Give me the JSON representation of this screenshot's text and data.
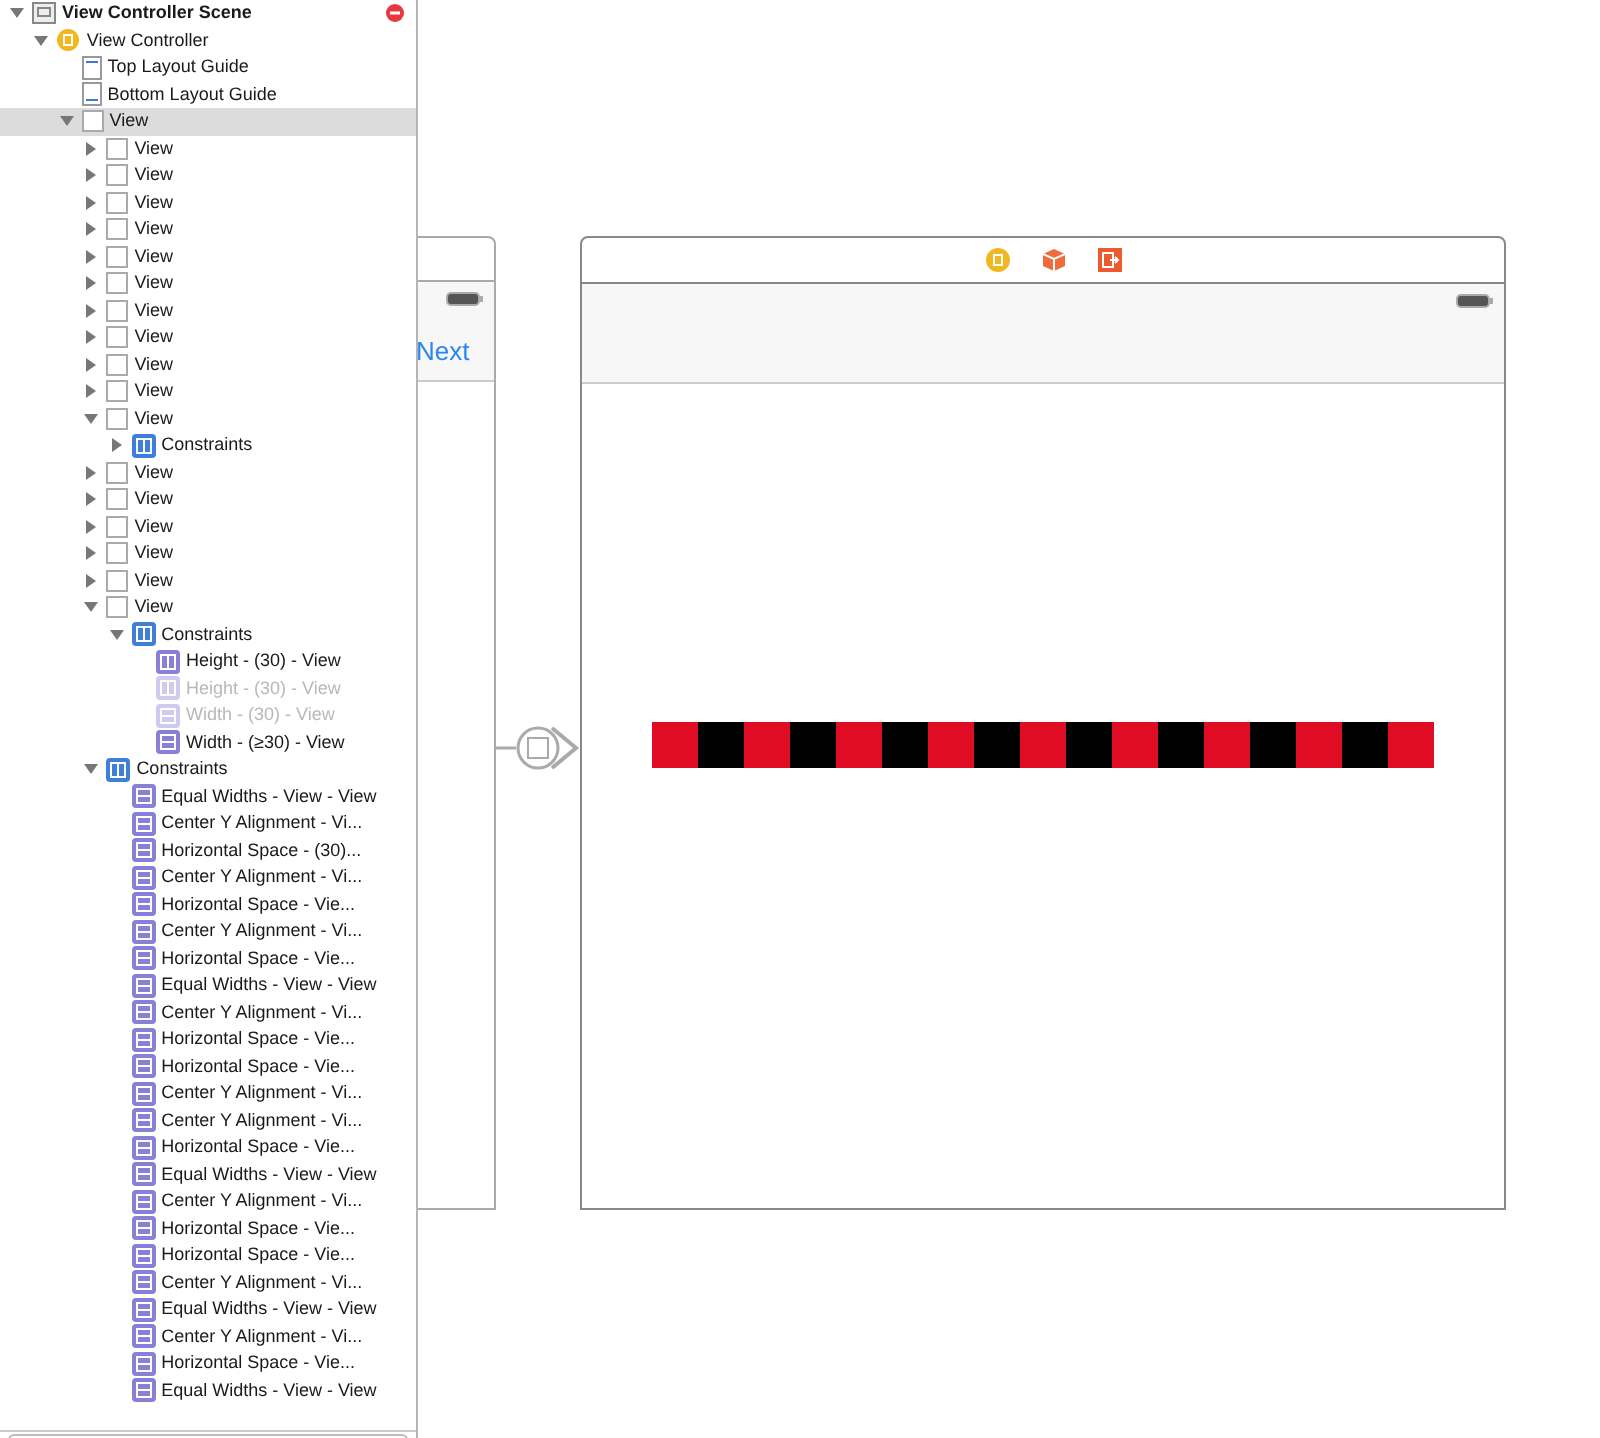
{
  "outline": [
    {
      "kind": "scene",
      "label": "View Controller Scene",
      "expanded": true,
      "selected": false,
      "children": [
        {
          "kind": "controller",
          "label": "View Controller",
          "expanded": true,
          "selected": false,
          "children": [
            {
              "kind": "guide_top",
              "label": "Top Layout Guide",
              "selected": false
            },
            {
              "kind": "guide_bottom",
              "label": "Bottom Layout Guide",
              "selected": false
            },
            {
              "kind": "view",
              "label": "View",
              "expanded": true,
              "selected": true,
              "children": [
                {
                  "kind": "view",
                  "label": "View",
                  "expanded": false,
                  "selected": false
                },
                {
                  "kind": "view",
                  "label": "View",
                  "expanded": false,
                  "selected": false
                },
                {
                  "kind": "view",
                  "label": "View",
                  "expanded": false,
                  "selected": false
                },
                {
                  "kind": "view",
                  "label": "View",
                  "expanded": false,
                  "selected": false
                },
                {
                  "kind": "view",
                  "label": "View",
                  "expanded": false,
                  "selected": false
                },
                {
                  "kind": "view",
                  "label": "View",
                  "expanded": false,
                  "selected": false
                },
                {
                  "kind": "view",
                  "label": "View",
                  "expanded": false,
                  "selected": false
                },
                {
                  "kind": "view",
                  "label": "View",
                  "expanded": false,
                  "selected": false
                },
                {
                  "kind": "view",
                  "label": "View",
                  "expanded": false,
                  "selected": false
                },
                {
                  "kind": "view",
                  "label": "View",
                  "expanded": false,
                  "selected": false
                },
                {
                  "kind": "view",
                  "label": "View",
                  "expanded": true,
                  "selected": false,
                  "children": [
                    {
                      "kind": "constraints",
                      "label": "Constraints",
                      "expanded": false,
                      "selected": false
                    }
                  ]
                },
                {
                  "kind": "view",
                  "label": "View",
                  "expanded": false,
                  "selected": false
                },
                {
                  "kind": "view",
                  "label": "View",
                  "expanded": false,
                  "selected": false
                },
                {
                  "kind": "view",
                  "label": "View",
                  "expanded": false,
                  "selected": false
                },
                {
                  "kind": "view",
                  "label": "View",
                  "expanded": false,
                  "selected": false
                },
                {
                  "kind": "view",
                  "label": "View",
                  "expanded": false,
                  "selected": false
                },
                {
                  "kind": "view",
                  "label": "View",
                  "expanded": true,
                  "selected": false,
                  "children": [
                    {
                      "kind": "constraints",
                      "label": "Constraints",
                      "expanded": true,
                      "selected": false,
                      "children": [
                        {
                          "kind": "height",
                          "label": "Height - (30) - View",
                          "disabled": false,
                          "selected": false
                        },
                        {
                          "kind": "height",
                          "label": "Height - (30) - View",
                          "disabled": true,
                          "selected": false
                        },
                        {
                          "kind": "width",
                          "label": "Width - (30) - View",
                          "disabled": true,
                          "selected": false
                        },
                        {
                          "kind": "width",
                          "label": "Width - (≥30) - View",
                          "disabled": false,
                          "selected": false
                        }
                      ]
                    }
                  ]
                },
                {
                  "kind": "constraints",
                  "label": "Constraints",
                  "expanded": true,
                  "selected": false,
                  "children": [
                    {
                      "kind": "equal_widths",
                      "label": "Equal Widths - View - View",
                      "selected": false
                    },
                    {
                      "kind": "center_y",
                      "label": "Center Y Alignment - Vi...",
                      "selected": false
                    },
                    {
                      "kind": "hspace",
                      "label": "Horizontal Space - (30)...",
                      "selected": false
                    },
                    {
                      "kind": "center_y",
                      "label": "Center Y Alignment - Vi...",
                      "selected": false
                    },
                    {
                      "kind": "hspace",
                      "label": "Horizontal Space - Vie...",
                      "selected": false
                    },
                    {
                      "kind": "center_y",
                      "label": "Center Y Alignment - Vi...",
                      "selected": false
                    },
                    {
                      "kind": "hspace",
                      "label": "Horizontal Space - Vie...",
                      "selected": false
                    },
                    {
                      "kind": "equal_widths",
                      "label": "Equal Widths - View - View",
                      "selected": false
                    },
                    {
                      "kind": "center_y",
                      "label": "Center Y Alignment - Vi...",
                      "selected": false
                    },
                    {
                      "kind": "hspace",
                      "label": "Horizontal Space - Vie...",
                      "selected": false
                    },
                    {
                      "kind": "hspace",
                      "label": "Horizontal Space - Vie...",
                      "selected": false
                    },
                    {
                      "kind": "center_y",
                      "label": "Center Y Alignment - Vi...",
                      "selected": false
                    },
                    {
                      "kind": "center_y",
                      "label": "Center Y Alignment - Vi...",
                      "selected": false
                    },
                    {
                      "kind": "hspace",
                      "label": "Horizontal Space - Vie...",
                      "selected": false
                    },
                    {
                      "kind": "equal_widths",
                      "label": "Equal Widths - View - View",
                      "selected": false
                    },
                    {
                      "kind": "center_y",
                      "label": "Center Y Alignment - Vi...",
                      "selected": false
                    },
                    {
                      "kind": "hspace",
                      "label": "Horizontal Space - Vie...",
                      "selected": false
                    },
                    {
                      "kind": "hspace",
                      "label": "Horizontal Space - Vie...",
                      "selected": false
                    },
                    {
                      "kind": "center_y",
                      "label": "Center Y Alignment - Vi...",
                      "selected": false
                    },
                    {
                      "kind": "equal_widths",
                      "label": "Equal Widths - View - View",
                      "selected": false
                    },
                    {
                      "kind": "center_y",
                      "label": "Center Y Alignment - Vi...",
                      "selected": false
                    },
                    {
                      "kind": "hspace",
                      "label": "Horizontal Space - Vie...",
                      "selected": false
                    },
                    {
                      "kind": "equal_widths",
                      "label": "Equal Widths - View - View",
                      "selected": false
                    }
                  ]
                }
              ]
            }
          ]
        }
      ]
    }
  ],
  "canvas": {
    "previous_scene": {
      "nav_button": "Next"
    },
    "color_views": [
      {
        "color": "#e00c24"
      },
      {
        "color": "#000000"
      },
      {
        "color": "#e00c24"
      },
      {
        "color": "#000000"
      },
      {
        "color": "#e00c24"
      },
      {
        "color": "#000000"
      },
      {
        "color": "#e00c24"
      },
      {
        "color": "#000000"
      },
      {
        "color": "#e00c24"
      },
      {
        "color": "#000000"
      },
      {
        "color": "#e00c24"
      },
      {
        "color": "#000000"
      },
      {
        "color": "#e00c24"
      },
      {
        "color": "#000000"
      },
      {
        "color": "#e00c24"
      },
      {
        "color": "#000000"
      },
      {
        "color": "#e00c24"
      }
    ]
  }
}
